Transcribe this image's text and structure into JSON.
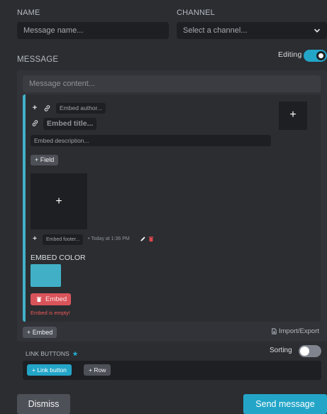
{
  "form": {
    "name_label": "NAME",
    "name_placeholder": "Message name...",
    "channel_label": "CHANNEL",
    "channel_placeholder": "Select a channel..."
  },
  "message": {
    "label": "MESSAGE",
    "editing_label": "Editing",
    "content_placeholder": "Message content..."
  },
  "embed": {
    "author_placeholder": "Embed author...",
    "title_placeholder": "Embed title...",
    "description_placeholder": "Embed description...",
    "field_button": "+ Field",
    "footer_placeholder": "Embed footer...",
    "timestamp": "• Today at 1:36 PM",
    "color_label": "EMBED COLOR",
    "color": "#41b0c7",
    "delete_button": "Embed",
    "error": "Embed is empty!",
    "plus": "+"
  },
  "actions": {
    "add_embed": "+ Embed",
    "import_export": "Import/Export"
  },
  "link_buttons": {
    "label": "LINK BUTTONS",
    "sorting_label": "Sorting",
    "add_link_button": "+ Link button",
    "add_row": "+ Row"
  },
  "footer": {
    "dismiss": "Dismiss",
    "send": "Send message"
  },
  "colors": {
    "accent": "#23a5c8",
    "danger": "#d9545a",
    "error_text": "#f05a5a"
  }
}
